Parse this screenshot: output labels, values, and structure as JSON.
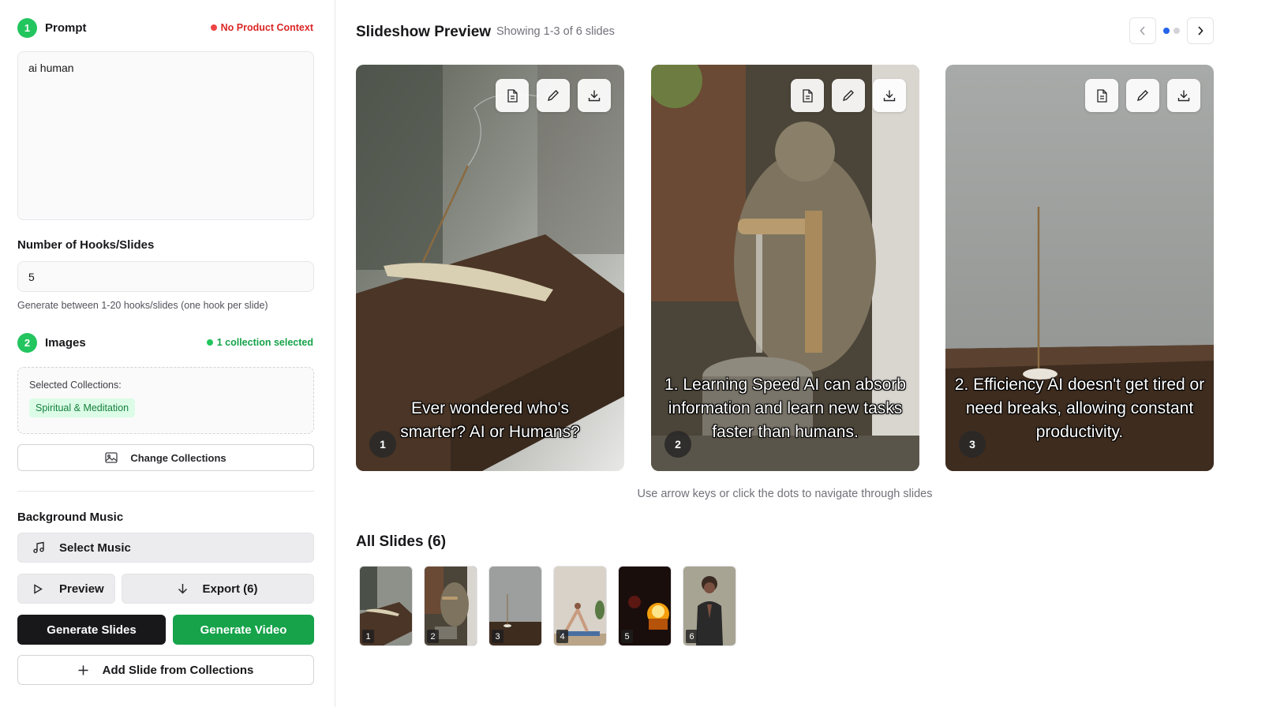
{
  "left_panel": {
    "prompt": {
      "step": "1",
      "title": "Prompt",
      "status": "No Product Context",
      "value": "ai human"
    },
    "hooks": {
      "label": "Number of Hooks/Slides",
      "value": "5",
      "hint": "Generate between 1-20 hooks/slides (one hook per slide)"
    },
    "images": {
      "step": "2",
      "title": "Images",
      "status": "1 collection selected",
      "selected_label": "Selected Collections:",
      "collections": [
        "Spiritual & Meditation"
      ],
      "change_button": "Change Collections"
    },
    "music": {
      "label": "Background Music",
      "select_button": "Select Music"
    },
    "actions": {
      "preview": "Preview",
      "export": "Export (6)",
      "generate_slides": "Generate Slides",
      "generate_video": "Generate Video",
      "add_slide": "Add Slide from Collections"
    }
  },
  "preview": {
    "title": "Slideshow Preview",
    "showing": "Showing 1-3 of 6 slides",
    "page_dots": [
      true,
      false
    ],
    "slides": [
      {
        "number": "1",
        "caption": "Ever wondered who's smarter? AI or Humans?"
      },
      {
        "number": "2",
        "caption": "1. Learning Speed AI can absorb information and learn new tasks faster than humans."
      },
      {
        "number": "3",
        "caption": "2. Efficiency AI doesn't get tired or need breaks, allowing constant productivity."
      }
    ],
    "nav_hint": "Use arrow keys or click the dots to navigate through slides"
  },
  "all_slides": {
    "title": "All Slides (6)",
    "thumbnails": [
      "1",
      "2",
      "3",
      "4",
      "5",
      "6"
    ]
  },
  "colors": {
    "accent_green": "#16a34a",
    "status_red": "#dc2626",
    "dark_button": "#18181b",
    "active_dot": "#2563eb"
  }
}
